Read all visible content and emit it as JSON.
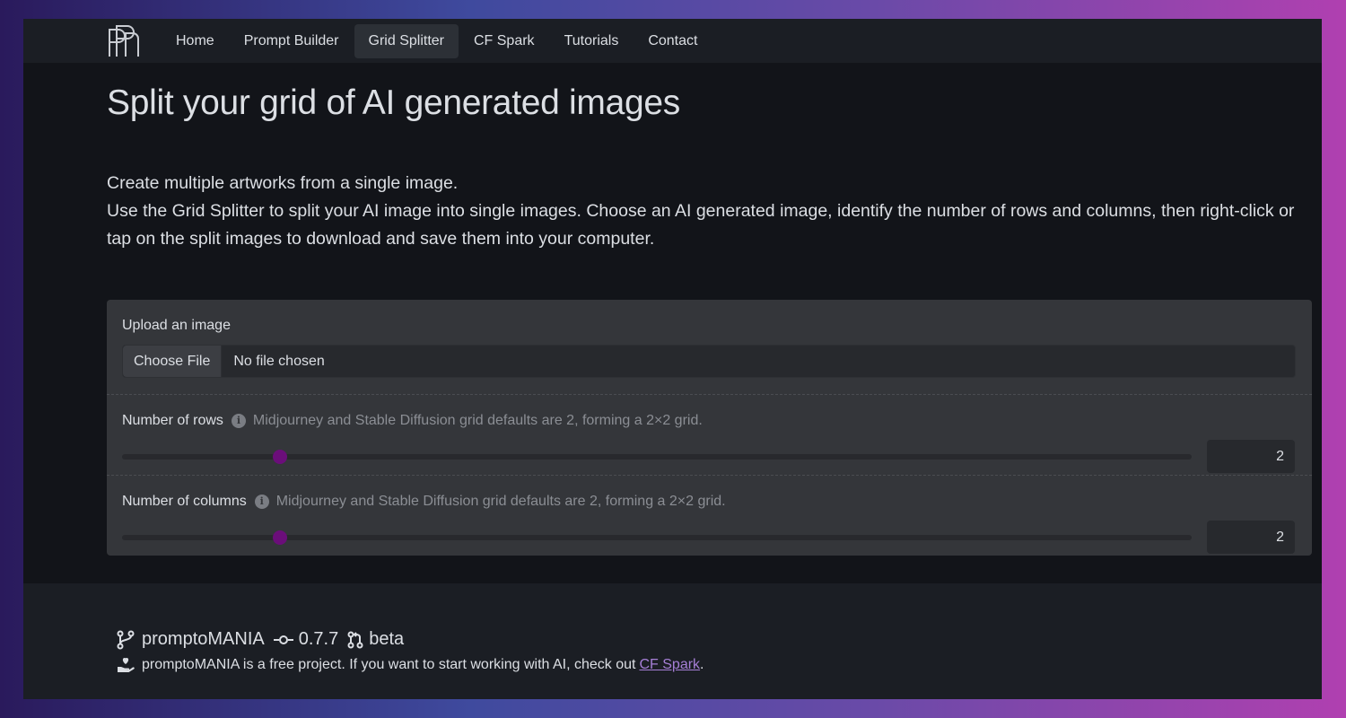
{
  "nav": {
    "items": [
      {
        "label": "Home",
        "active": false
      },
      {
        "label": "Prompt Builder",
        "active": false
      },
      {
        "label": "Grid Splitter",
        "active": true
      },
      {
        "label": "CF Spark",
        "active": false
      },
      {
        "label": "Tutorials",
        "active": false
      },
      {
        "label": "Contact",
        "active": false
      }
    ]
  },
  "page": {
    "title": "Split your grid of AI generated images",
    "intro_line1": "Create multiple artworks from a single image.",
    "intro_line2": "Use the Grid Splitter to split your AI image into single images. Choose an AI generated image, identify the number of rows and columns, then right-click or tap on the split images to download and save them into your computer."
  },
  "upload": {
    "label": "Upload an image",
    "button_label": "Choose File",
    "status": "No file chosen"
  },
  "rows": {
    "label": "Number of rows",
    "hint": "Midjourney and Stable Diffusion grid defaults are 2, forming a 2×2 grid.",
    "value": "2",
    "slider_fraction": 0.148
  },
  "columns": {
    "label": "Number of columns",
    "hint": "Midjourney and Stable Diffusion grid defaults are 2, forming a 2×2 grid.",
    "value": "2",
    "slider_fraction": 0.148
  },
  "footer": {
    "name": "promptoMANIA",
    "version": "0.7.7",
    "channel": "beta",
    "note": "promptoMANIA is a free project. If you want to start working with AI, check out ",
    "link_label": "CF Spark",
    "note_end": "."
  },
  "colors": {
    "slider_thumb": "#6b0e7a",
    "link": "#a67fd6"
  }
}
